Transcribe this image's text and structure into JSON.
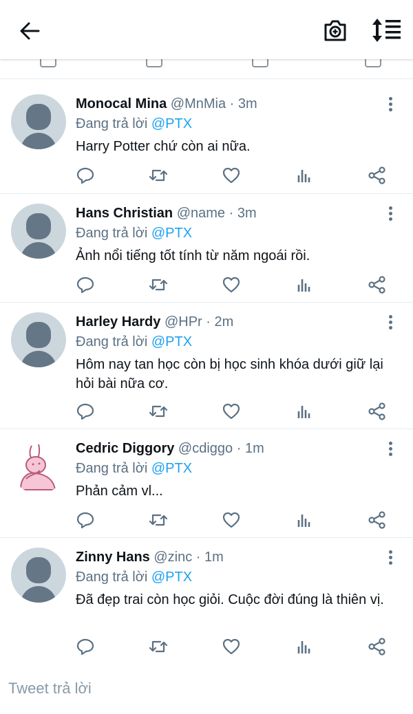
{
  "compose": {
    "placeholder": "Tweet trả lời"
  },
  "tweets": [
    {
      "name": "Monocal Mina",
      "handle": "@MnMia",
      "time": "3m",
      "replying_prefix": "Đang trả lời",
      "mention": "@PTX",
      "text": "Harry Potter chứ còn ai nữa.",
      "avatar": "default"
    },
    {
      "name": "Hans Christian",
      "handle": "@name",
      "time": "3m",
      "replying_prefix": "Đang trả lời",
      "mention": "@PTX",
      "text": "Ảnh nổi tiếng tốt tính từ năm ngoái rồi.",
      "avatar": "default"
    },
    {
      "name": "Harley Hardy",
      "handle": "@HPr",
      "time": "2m",
      "replying_prefix": "Đang trả lời",
      "mention": "@PTX",
      "text": "Hôm nay tan học còn bị học sinh khóa dưới giữ lại hỏi bài nữa cơ.",
      "avatar": "default"
    },
    {
      "name": "Cedric Diggory",
      "handle": "@cdiggo",
      "time": "1m",
      "replying_prefix": "Đang trả lời",
      "mention": "@PTX",
      "text": "Phản cảm vl...",
      "avatar": "rabbit"
    },
    {
      "name": "Zinny Hans",
      "handle": "@zinc",
      "time": "1m",
      "replying_prefix": "Đang trả lời",
      "mention": "@PTX",
      "text": "Đã đẹp trai còn học giỏi. Cuộc đời đúng là thiên vị.",
      "avatar": "default"
    }
  ],
  "colors": {
    "link": "#1da1f2",
    "muted": "#5b7083",
    "text": "#0f1419",
    "avatar_bg": "#ccd6dd",
    "avatar_fg": "#657786"
  },
  "icons": [
    "back-arrow-icon",
    "camera-icon",
    "sort-icon",
    "reply-icon",
    "retweet-icon",
    "like-icon",
    "analytics-icon",
    "share-icon",
    "more-icon"
  ]
}
